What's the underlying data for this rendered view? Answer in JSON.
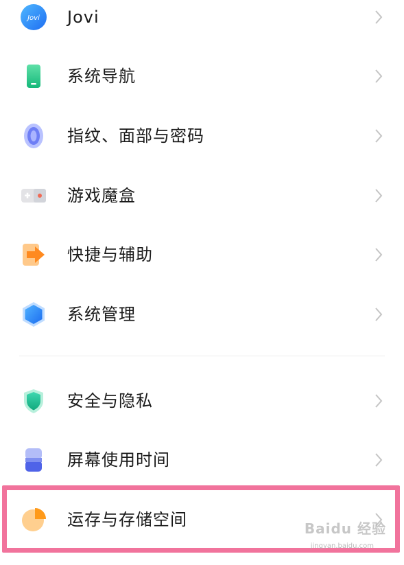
{
  "settings": {
    "items": [
      {
        "label": "Jovi",
        "icon": "jovi-icon",
        "icon_text": "Jovi"
      },
      {
        "label": "系统导航",
        "icon": "phone-navigation-icon"
      },
      {
        "label": "指纹、面部与密码",
        "icon": "fingerprint-icon"
      },
      {
        "label": "游戏魔盒",
        "icon": "gamepad-icon"
      },
      {
        "label": "快捷与辅助",
        "icon": "shortcut-arrow-icon"
      },
      {
        "label": "系统管理",
        "icon": "hexagon-icon"
      },
      {
        "label": "安全与隐私",
        "icon": "shield-icon"
      },
      {
        "label": "屏幕使用时间",
        "icon": "hourglass-icon"
      },
      {
        "label": "运存与存储空间",
        "icon": "pie-chart-icon"
      }
    ]
  },
  "watermark": {
    "brand": "Baidu 经验",
    "url": "jingyan.baidu.com"
  }
}
